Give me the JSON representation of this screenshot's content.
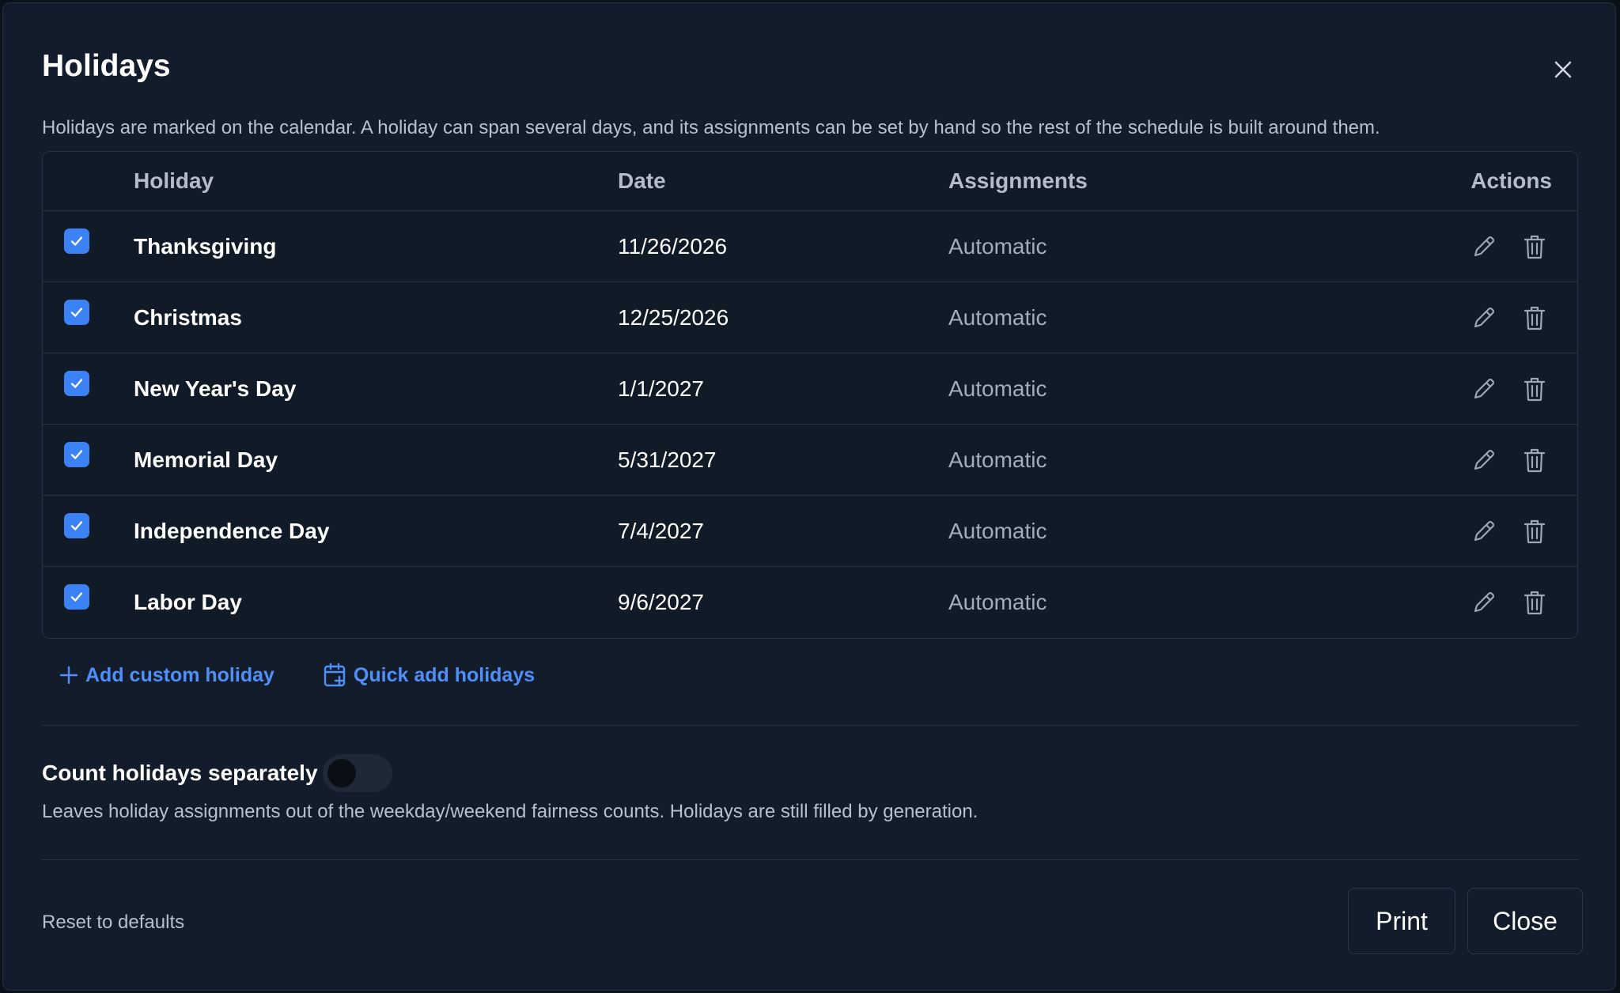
{
  "dialog": {
    "title": "Holidays",
    "description": "Holidays are marked on the calendar. A holiday can span several days, and its assignments can be set by hand so the rest of the schedule is built around them."
  },
  "table": {
    "headers": {
      "holiday": "Holiday",
      "date": "Date",
      "assignments": "Assignments",
      "actions": "Actions"
    },
    "rows": [
      {
        "checked": true,
        "name": "Thanksgiving",
        "date": "11/26/2026",
        "assignments": "Automatic"
      },
      {
        "checked": true,
        "name": "Christmas",
        "date": "12/25/2026",
        "assignments": "Automatic"
      },
      {
        "checked": true,
        "name": "New Year's Day",
        "date": "1/1/2027",
        "assignments": "Automatic"
      },
      {
        "checked": true,
        "name": "Memorial Day",
        "date": "5/31/2027",
        "assignments": "Automatic"
      },
      {
        "checked": true,
        "name": "Independence Day",
        "date": "7/4/2027",
        "assignments": "Automatic"
      },
      {
        "checked": true,
        "name": "Labor Day",
        "date": "9/6/2027",
        "assignments": "Automatic"
      }
    ]
  },
  "links": {
    "add_custom": "Add custom holiday",
    "quick_add": "Quick add holidays"
  },
  "count_separately": {
    "label": "Count holidays separately",
    "enabled": false,
    "help": "Leaves holiday assignments out of the weekday/weekend fairness counts. Holidays are still filled by generation."
  },
  "footer": {
    "reset": "Reset to defaults",
    "print": "Print",
    "close": "Close"
  },
  "colors": {
    "accent": "#3b82f6",
    "background": "#121c2a",
    "border": "#263345"
  },
  "icons": {
    "close": "close-icon",
    "edit": "pencil-icon",
    "delete": "trash-icon",
    "add": "plus-icon",
    "quick_add": "calendar-plus-icon",
    "check": "check-icon"
  }
}
